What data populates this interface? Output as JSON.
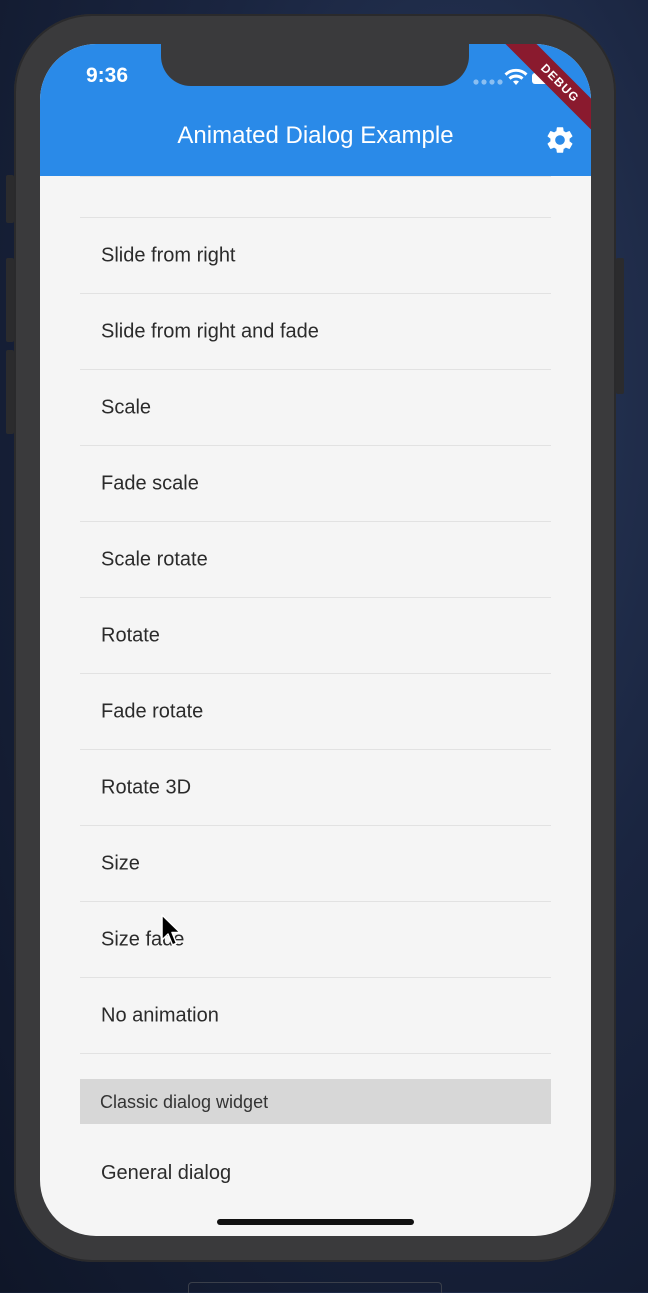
{
  "status_bar": {
    "time": "9:36",
    "debug_label": "DEBUG"
  },
  "app_bar": {
    "title": "Animated Dialog Example",
    "settings_icon": "gear-icon"
  },
  "animation_list": {
    "items": [
      {
        "label": ""
      },
      {
        "label": "Slide from right"
      },
      {
        "label": "Slide from right and fade"
      },
      {
        "label": "Scale"
      },
      {
        "label": "Fade scale"
      },
      {
        "label": "Scale rotate"
      },
      {
        "label": "Rotate"
      },
      {
        "label": "Fade rotate"
      },
      {
        "label": "Rotate 3D"
      },
      {
        "label": "Size"
      },
      {
        "label": "Size fade"
      },
      {
        "label": "No animation"
      }
    ]
  },
  "classic_section": {
    "header": "Classic dialog widget",
    "items": [
      {
        "label": "General dialog"
      }
    ]
  },
  "colors": {
    "app_bar": "#2a8ae8",
    "background": "#f5f5f5",
    "section_header": "#d7d7d7",
    "debug_banner": "#8a1a2e"
  }
}
